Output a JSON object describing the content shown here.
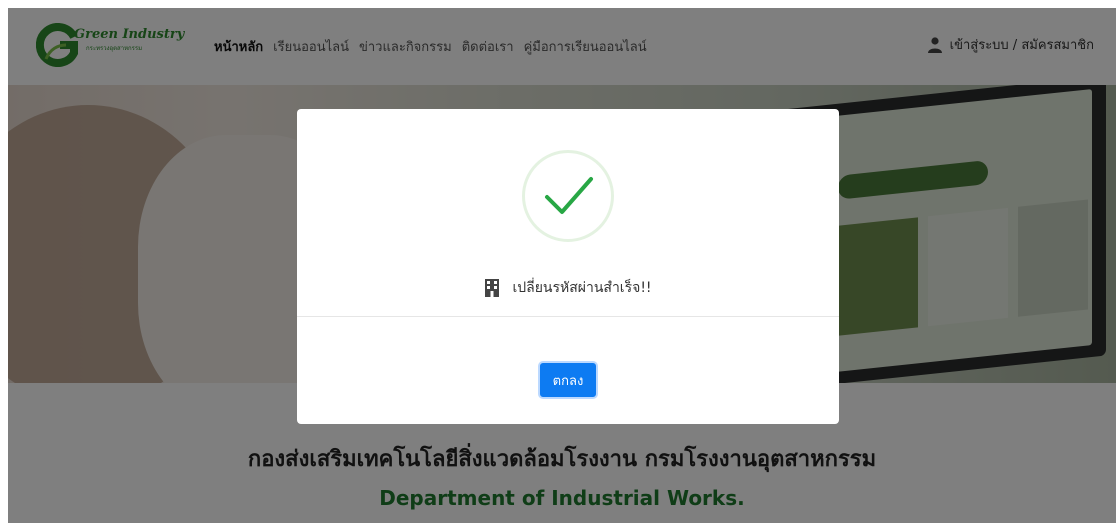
{
  "logo": {
    "title": "Green Industry",
    "subtitle": "กระทรวงอุตสาหกรรม"
  },
  "nav": {
    "items": [
      {
        "label": "หน้าหลัก",
        "active": true
      },
      {
        "label": "เรียนออนไลน์",
        "active": false
      },
      {
        "label": "ข่าวและกิจกรรม",
        "active": false
      },
      {
        "label": "ติดต่อเรา",
        "active": false
      },
      {
        "label": "คู่มือการเรียนออนไลน์",
        "active": false
      }
    ],
    "login_label": "เข้าสู่ระบบ / สมัครสมาชิก"
  },
  "content": {
    "department_th": "กองส่งเสริมเทคโนโลยีสิ่งแวดล้อมโรงงาน กรมโรงงานอุตสาหกรรม",
    "department_en": "Department of Industrial Works."
  },
  "modal": {
    "message": "เปลี่ยนรหัสผ่านสำเร็จ!!",
    "ok_label": "ตกลง"
  },
  "colors": {
    "brand_green": "#2e8b2e",
    "success_check": "#28a745",
    "primary_button": "#0d7bf2"
  }
}
